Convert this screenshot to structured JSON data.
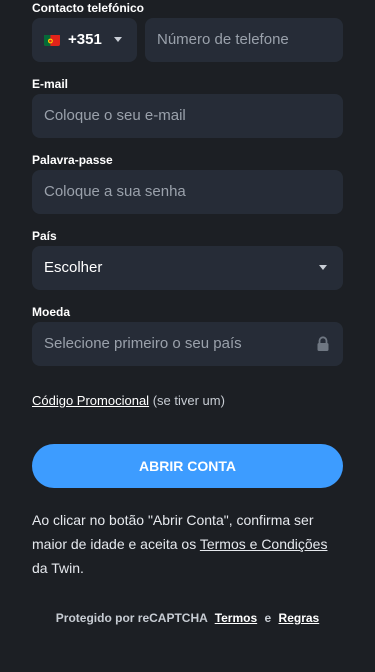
{
  "phone": {
    "label": "Contacto telefónico",
    "country_code": "+351",
    "country_flag": "portugal-flag-icon",
    "placeholder": "Número de telefone"
  },
  "email": {
    "label": "E-mail",
    "placeholder": "Coloque o seu e-mail"
  },
  "password": {
    "label": "Palavra-passe",
    "placeholder": "Coloque a sua senha"
  },
  "country": {
    "label": "País",
    "value": "Escolher"
  },
  "currency": {
    "label": "Moeda",
    "placeholder": "Selecione primeiro o seu país",
    "lock_icon": "lock-icon"
  },
  "promo": {
    "link": "Código Promocional",
    "hint": "(se tiver um)"
  },
  "submit": {
    "label": "ABRIR CONTA"
  },
  "terms": {
    "prefix": "Ao clicar no botão \"Abrir Conta\", confirma ser maior de idade e aceita os",
    "link": "Termos e Condições",
    "suffix": "da Twin."
  },
  "captcha": {
    "prefix": "Protegido por reCAPTCHA",
    "terms_link": "Termos",
    "conjunction": "e",
    "rules_link": "Regras"
  },
  "colors": {
    "background": "#1c1f24",
    "input": "#262c37",
    "accent": "#3d9cff"
  }
}
